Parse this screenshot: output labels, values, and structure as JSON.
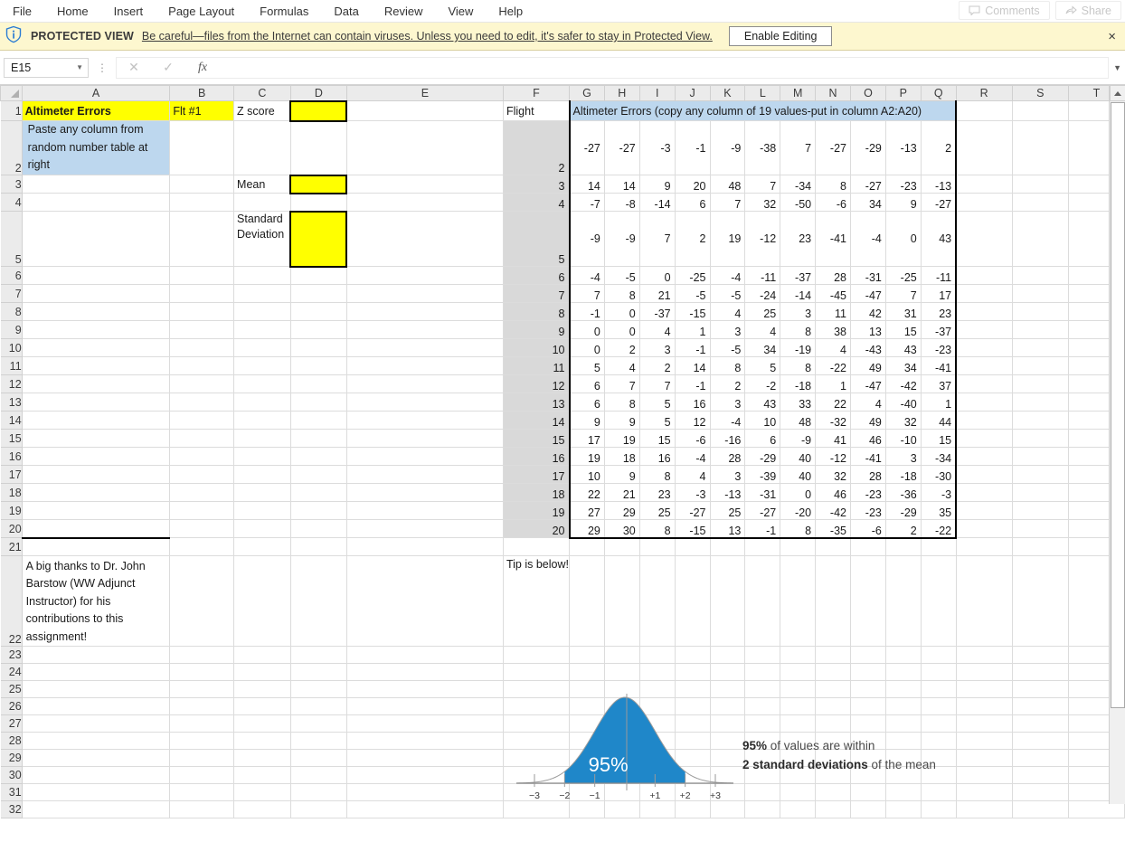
{
  "ribbon": {
    "tabs": [
      "File",
      "Home",
      "Insert",
      "Page Layout",
      "Formulas",
      "Data",
      "Review",
      "View",
      "Help"
    ],
    "comments_label": "Comments",
    "share_label": "Share"
  },
  "protected_view": {
    "title": "PROTECTED VIEW",
    "message": "Be careful—files from the Internet can contain viruses. Unless you need to edit, it's safer to stay in Protected View.",
    "enable_label": "Enable Editing",
    "close_label": "×",
    "bar_color": "#fdf7cf"
  },
  "formula_bar": {
    "name_box_value": "E15",
    "cancel_icon": "✕",
    "confirm_icon": "✓",
    "function_icon": "fx",
    "formula_value": ""
  },
  "grid": {
    "columns": [
      "A",
      "B",
      "C",
      "D",
      "E",
      "F",
      "G",
      "H",
      "I",
      "J",
      "K",
      "L",
      "M",
      "N",
      "O",
      "P",
      "Q",
      "R",
      "S",
      "T"
    ],
    "rows": [
      1,
      2,
      3,
      4,
      5,
      6,
      7,
      8,
      9,
      10,
      11,
      12,
      13,
      14,
      15,
      16,
      17,
      18,
      19,
      20,
      21,
      22,
      23,
      24,
      25,
      26,
      27,
      28,
      29,
      30,
      31,
      32
    ]
  },
  "labels": {
    "a1": "Altimeter Errors",
    "b1": "Flt #1",
    "c1": "Z score",
    "d1": "",
    "a2": "Paste any column from random number table at right",
    "c3": "Mean",
    "d3": "",
    "c5": "Standard Deviation",
    "d5": "",
    "f1": "Flight",
    "g1_banner": "Altimeter Errors (copy any column of 19 values-put in column A2:A20)",
    "a22": "A big thanks to Dr. John Barstow (WW Adjunct Instructor) for his contributions to this assignment!",
    "f22": "Tip is below!"
  },
  "colors": {
    "highlight_yellow": "#ffff00",
    "fill_blue": "#bdd7ee",
    "chart_blue": "#1f87c9"
  },
  "table_data": {
    "flight_header": "Flight",
    "data_columns": [
      "G",
      "H",
      "I",
      "J",
      "K",
      "L",
      "M",
      "N",
      "O",
      "P",
      "Q"
    ],
    "rows": [
      {
        "flight": 2,
        "values": [
          -27,
          -27,
          -3,
          -1,
          -9,
          -38,
          7,
          -27,
          -29,
          -13,
          2
        ]
      },
      {
        "flight": 3,
        "values": [
          14,
          14,
          9,
          20,
          48,
          7,
          -34,
          8,
          -27,
          -23,
          -13
        ]
      },
      {
        "flight": 4,
        "values": [
          -7,
          -8,
          -14,
          6,
          7,
          32,
          -50,
          -6,
          34,
          9,
          -27
        ]
      },
      {
        "flight": 5,
        "values": [
          -9,
          -9,
          7,
          2,
          19,
          -12,
          23,
          -41,
          -4,
          0,
          43
        ]
      },
      {
        "flight": 6,
        "values": [
          -4,
          -5,
          0,
          -25,
          -4,
          -11,
          -37,
          28,
          -31,
          -25,
          -11
        ]
      },
      {
        "flight": 7,
        "values": [
          7,
          8,
          21,
          -5,
          -5,
          -24,
          -14,
          -45,
          -47,
          7,
          17
        ]
      },
      {
        "flight": 8,
        "values": [
          -1,
          0,
          -37,
          -15,
          4,
          25,
          3,
          11,
          42,
          31,
          23
        ]
      },
      {
        "flight": 9,
        "values": [
          0,
          0,
          4,
          1,
          3,
          4,
          8,
          38,
          13,
          15,
          -37
        ]
      },
      {
        "flight": 10,
        "values": [
          0,
          2,
          3,
          -1,
          -5,
          34,
          -19,
          4,
          -43,
          43,
          -23
        ]
      },
      {
        "flight": 11,
        "values": [
          5,
          4,
          2,
          14,
          8,
          5,
          8,
          -22,
          49,
          34,
          -41
        ]
      },
      {
        "flight": 12,
        "values": [
          6,
          7,
          7,
          -1,
          2,
          -2,
          -18,
          1,
          -47,
          -42,
          37
        ]
      },
      {
        "flight": 13,
        "values": [
          6,
          8,
          5,
          16,
          3,
          43,
          33,
          22,
          4,
          -40,
          1
        ]
      },
      {
        "flight": 14,
        "values": [
          9,
          9,
          5,
          12,
          -4,
          10,
          48,
          -32,
          49,
          32,
          44
        ]
      },
      {
        "flight": 15,
        "values": [
          17,
          19,
          15,
          -6,
          -16,
          6,
          -9,
          41,
          46,
          -10,
          15
        ]
      },
      {
        "flight": 16,
        "values": [
          19,
          18,
          16,
          -4,
          28,
          -29,
          40,
          -12,
          -41,
          3,
          -34
        ]
      },
      {
        "flight": 17,
        "values": [
          10,
          9,
          8,
          4,
          3,
          -39,
          40,
          32,
          28,
          -18,
          -30
        ]
      },
      {
        "flight": 18,
        "values": [
          22,
          21,
          23,
          -3,
          -13,
          -31,
          0,
          46,
          -23,
          -36,
          -3
        ]
      },
      {
        "flight": 19,
        "values": [
          27,
          29,
          25,
          -27,
          25,
          -27,
          -20,
          -42,
          -23,
          -29,
          35
        ]
      },
      {
        "flight": 20,
        "values": [
          29,
          30,
          8,
          -15,
          13,
          -1,
          8,
          -35,
          -6,
          2,
          -22
        ]
      }
    ]
  },
  "chart_data": {
    "type": "area",
    "title": "",
    "xlabel": "",
    "ylabel": "",
    "tick_labels": [
      "−3",
      "−2",
      "−1",
      "+1",
      "+2",
      "+3"
    ],
    "shaded_label": "95%",
    "shaded_range": [
      -2,
      2
    ],
    "xlim": [
      -3.6,
      3.6
    ],
    "annotation_bold_1": "95%",
    "annotation_text_1": " of values are within",
    "annotation_bold_2": "2 standard deviations",
    "annotation_text_2": " of the mean",
    "curve_color": "#1f87c9",
    "axis_color": "#8a8a8a"
  }
}
